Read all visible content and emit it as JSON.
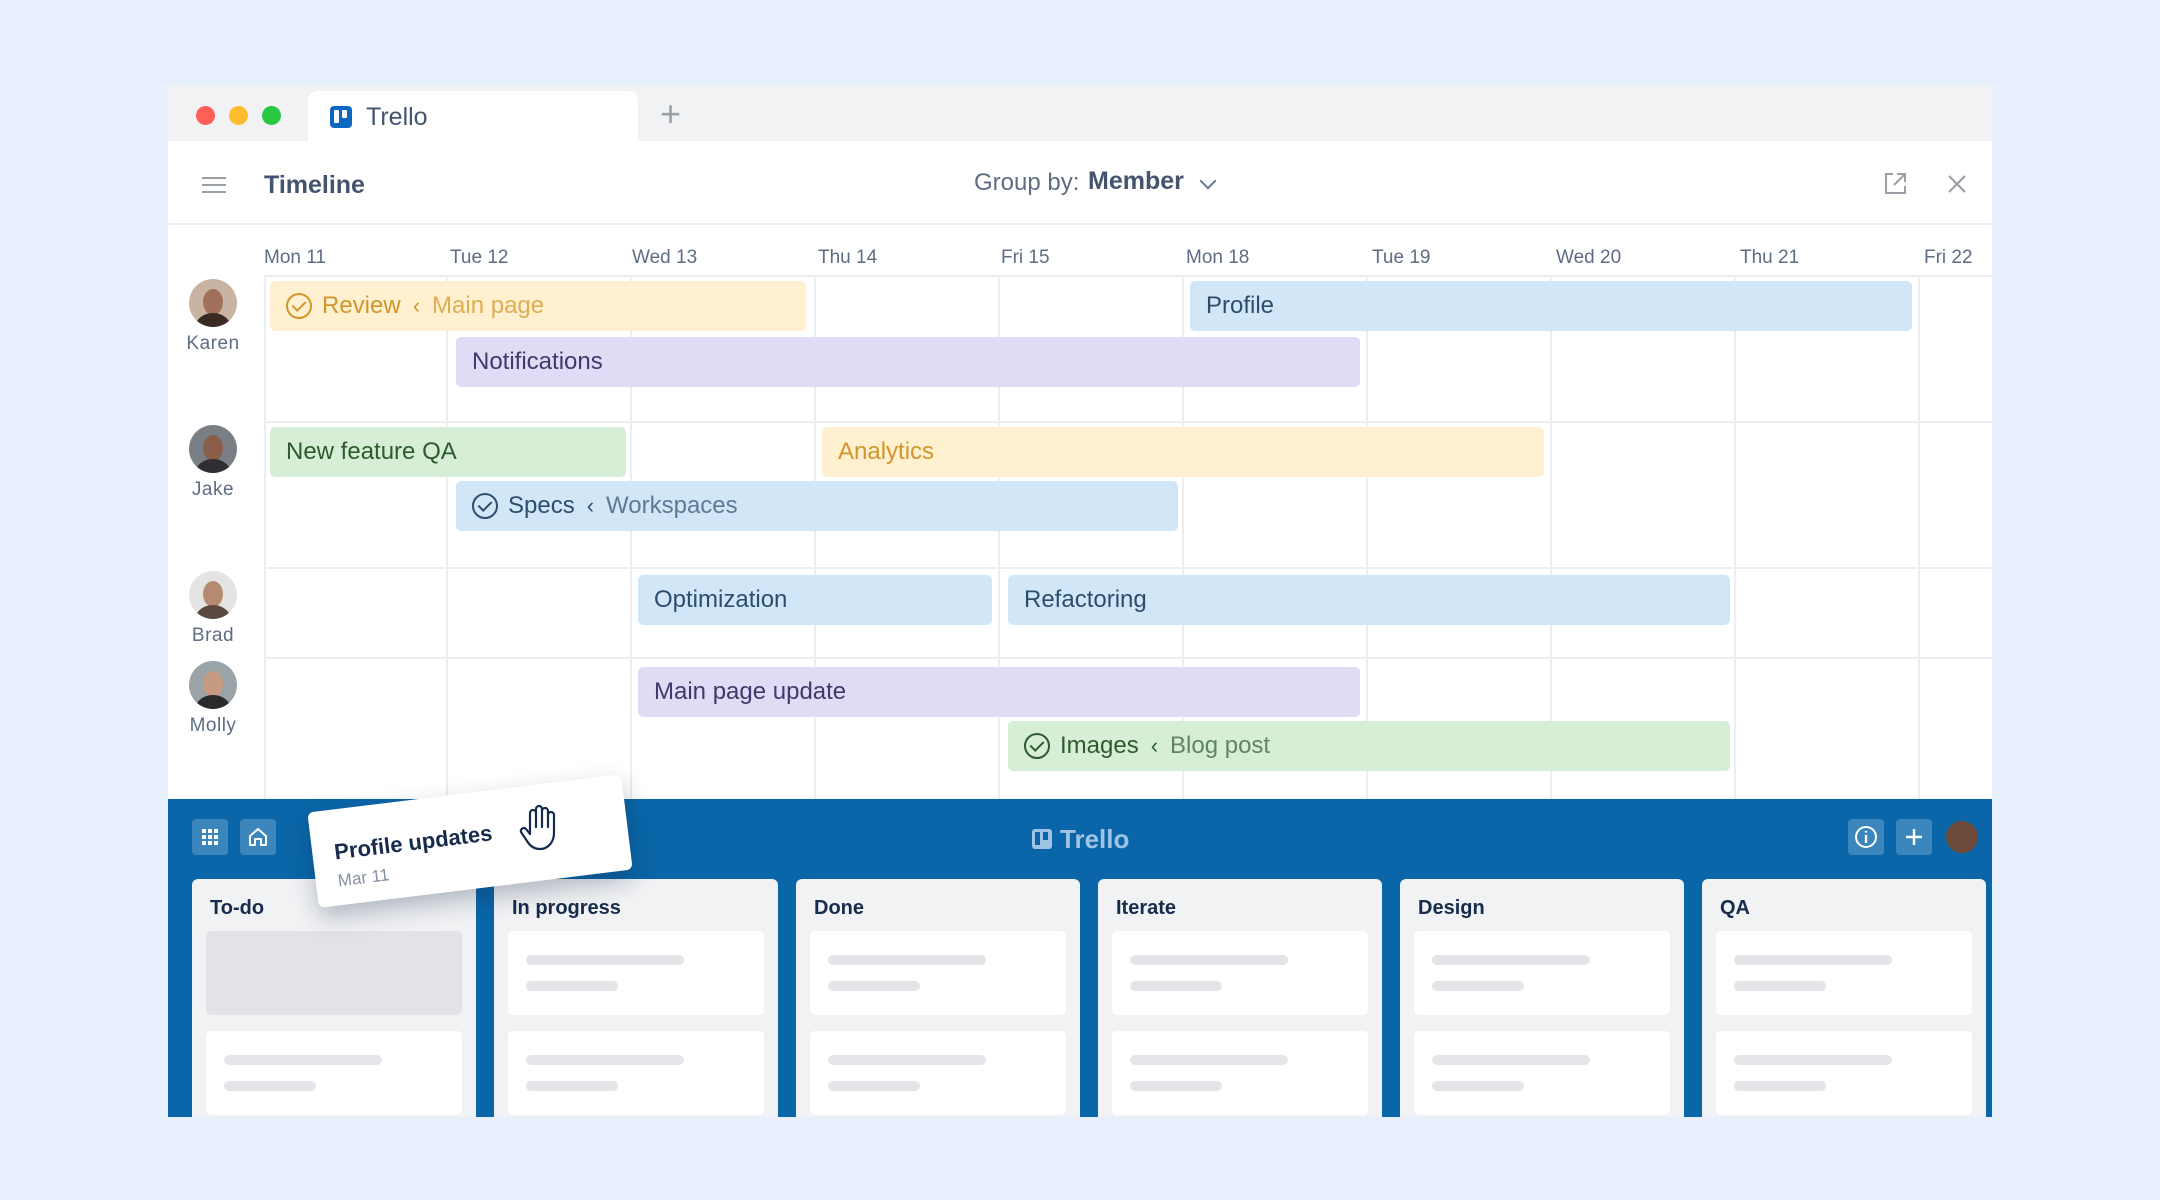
{
  "browser": {
    "tab_title": "Trello",
    "new_tab_symbol": "+"
  },
  "header": {
    "title": "Timeline",
    "group_by_label": "Group by:",
    "group_by_value": "Member"
  },
  "timeline": {
    "days": [
      "Mon 11",
      "Tue 12",
      "Wed 13",
      "Thu 14",
      "Fri 15",
      "Mon 18",
      "Tue 19",
      "Wed 20",
      "Thu 21",
      "Fri 22"
    ],
    "members": [
      "Karen",
      "Jake",
      "Brad",
      "Molly"
    ],
    "bars": {
      "review": {
        "label": "Review",
        "parent": "Main page",
        "separator": "‹"
      },
      "profile": {
        "label": "Profile"
      },
      "notifications": {
        "label": "Notifications"
      },
      "new_feature_qa": {
        "label": "New feature QA"
      },
      "analytics": {
        "label": "Analytics"
      },
      "specs": {
        "label": "Specs",
        "parent": "Workspaces",
        "separator": "‹"
      },
      "optimization": {
        "label": "Optimization"
      },
      "refactoring": {
        "label": "Refactoring"
      },
      "main_page_update": {
        "label": "Main page update"
      },
      "images": {
        "label": "Images",
        "parent": "Blog post",
        "separator": "‹"
      }
    }
  },
  "board": {
    "brand": "Trello",
    "columns": [
      "To-do",
      "In progress",
      "Done",
      "Iterate",
      "Design",
      "QA"
    ]
  },
  "dragged_card": {
    "title": "Profile updates",
    "date": "Mar 11"
  },
  "colors": {
    "board_blue": "#0a66a8",
    "page_bg": "#e8effc",
    "bar_yellow": "#fff0cf",
    "bar_blue": "#d1e7f7",
    "bar_purple": "#e2dbf5",
    "bar_green": "#d6eed5"
  }
}
